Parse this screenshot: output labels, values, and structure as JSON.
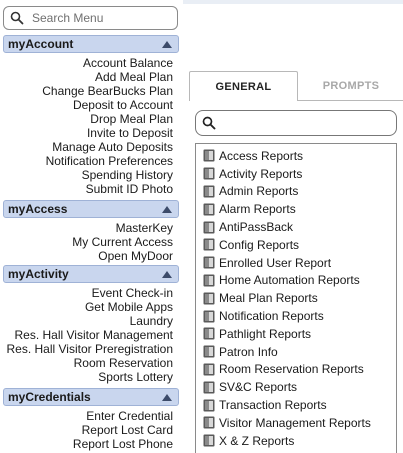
{
  "search": {
    "placeholder": "Search Menu"
  },
  "sections": [
    {
      "title": "myAccount",
      "items": [
        "Account Balance",
        "Add Meal Plan",
        "Change BearBucks Plan",
        "Deposit to Account",
        "Drop Meal Plan",
        "Invite to Deposit",
        "Manage Auto Deposits",
        "Notification Preferences",
        "Spending History",
        "Submit ID Photo"
      ]
    },
    {
      "title": "myAccess",
      "items": [
        "MasterKey",
        "My Current Access",
        "Open MyDoor"
      ]
    },
    {
      "title": "myActivity",
      "items": [
        "Event Check-in",
        "Get Mobile Apps",
        "Laundry",
        "Res. Hall Visitor Management",
        "Res. Hall Visitor Preregistration",
        "Room Reservation",
        "Sports Lottery"
      ]
    },
    {
      "title": "myCredentials",
      "items": [
        "Enter Credential",
        "Report Lost Card",
        "Report Lost Phone"
      ]
    }
  ],
  "tabs": {
    "general": "GENERAL",
    "prompts": "PROMPTS"
  },
  "reports": [
    "Access Reports",
    "Activity Reports",
    "Admin Reports",
    "Alarm Reports",
    "AntiPassBack",
    "Config Reports",
    "Enrolled User Report",
    "Home Automation Reports",
    "Meal Plan Reports",
    "Notification Reports",
    "Pathlight Reports",
    "Patron Info",
    "Room Reservation Reports",
    "SV&C Reports",
    "Transaction Reports",
    "Visitor Management Reports",
    "X & Z Reports"
  ],
  "colors": {
    "section_header_bg": "#c9d6ee",
    "section_header_border": "#9fb2d6",
    "active_tab_text": "#222222",
    "inactive_tab_text": "#a8a8a8"
  },
  "icons": {
    "search": "magnifier-icon",
    "report": "folder-icon",
    "section_toggle": "caret-up-icon"
  }
}
